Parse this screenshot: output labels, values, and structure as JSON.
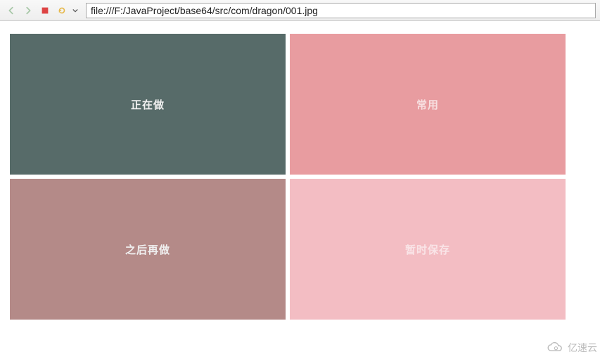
{
  "toolbar": {
    "url": "file:///F:/JavaProject/base64/src/com/dragon/001.jpg"
  },
  "tiles": [
    {
      "label": "正在做",
      "bg": "#576b69"
    },
    {
      "label": "常用",
      "bg": "#e89ca0"
    },
    {
      "label": "之后再做",
      "bg": "#b48a88"
    },
    {
      "label": "暂时保存",
      "bg": "#f3bdc3"
    }
  ],
  "watermark": {
    "text": "亿速云"
  }
}
